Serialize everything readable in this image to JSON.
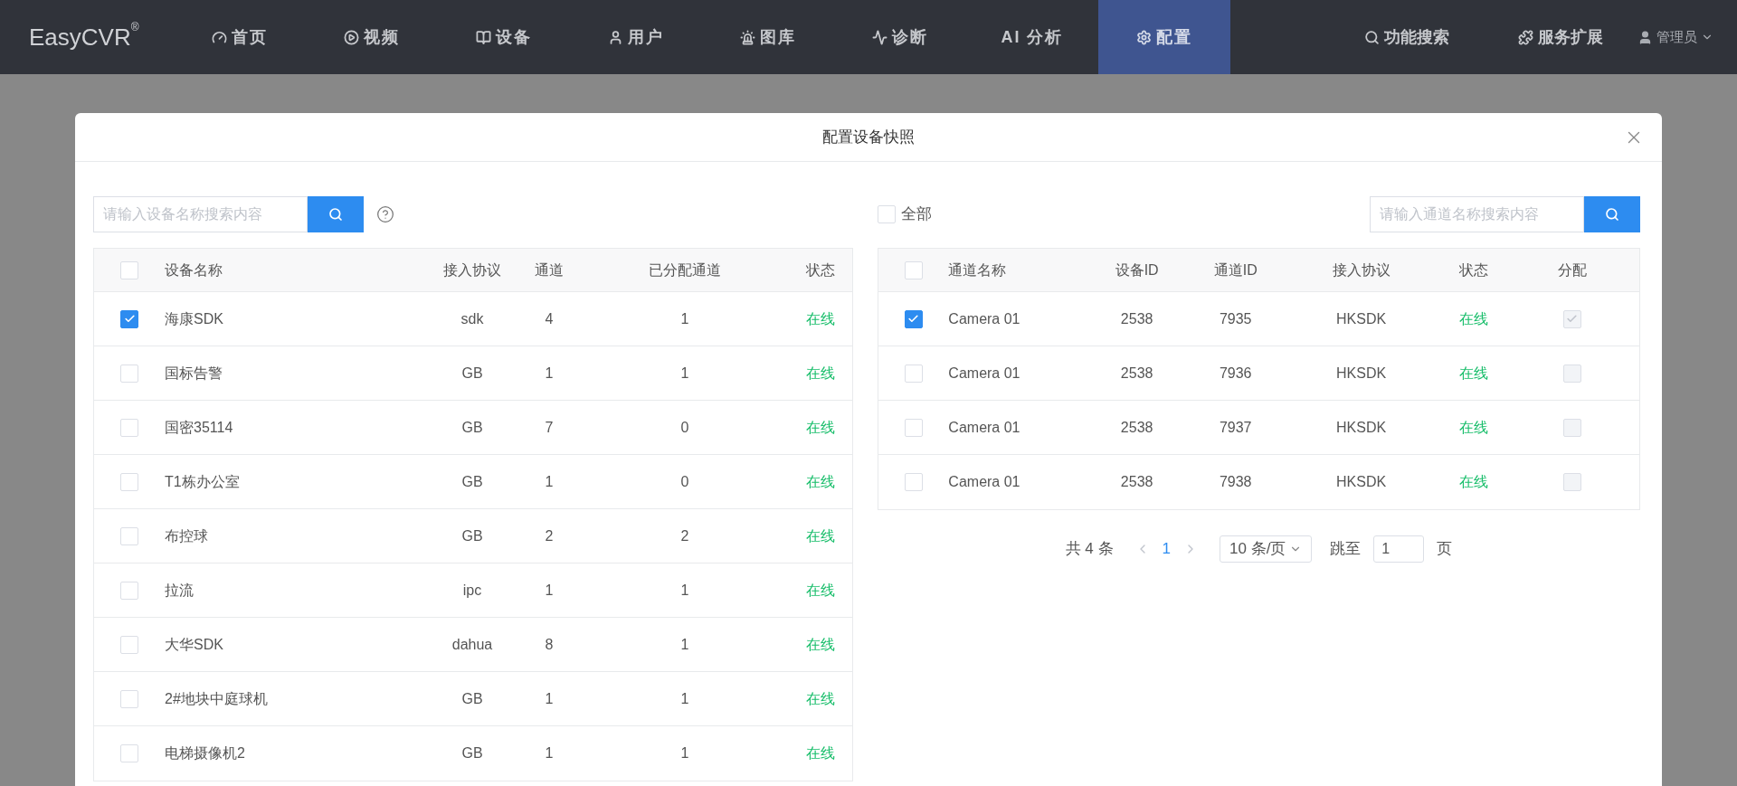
{
  "navbar": {
    "logo": "EasyCVR",
    "logo_mark": "®",
    "items": [
      {
        "label": "首页",
        "selected": false
      },
      {
        "label": "视频",
        "selected": false
      },
      {
        "label": "设备",
        "selected": false
      },
      {
        "label": "用户",
        "selected": false
      },
      {
        "label": "图库",
        "selected": false
      },
      {
        "label": "诊断",
        "selected": false
      },
      {
        "label": "AI 分析",
        "selected": false
      },
      {
        "label": "配置",
        "selected": true
      }
    ],
    "right_items": [
      {
        "label": "功能搜索"
      },
      {
        "label": "服务扩展"
      }
    ],
    "user": "管理员"
  },
  "dialog": {
    "title": "配置设备快照",
    "left": {
      "search": {
        "placeholder": "请输入设备名称搜索内容"
      },
      "header_checked": false,
      "columns": [
        "设备名称",
        "接入协议",
        "通道",
        "已分配通道",
        "状态"
      ],
      "rows": [
        {
          "checked": true,
          "cells": [
            "海康SDK",
            "sdk",
            "4",
            "1",
            "在线"
          ]
        },
        {
          "checked": false,
          "cells": [
            "国标告警",
            "GB",
            "1",
            "1",
            "在线"
          ]
        },
        {
          "checked": false,
          "cells": [
            "国密35114",
            "GB",
            "7",
            "0",
            "在线"
          ]
        },
        {
          "checked": false,
          "cells": [
            "T1栋办公室",
            "GB",
            "1",
            "0",
            "在线"
          ]
        },
        {
          "checked": false,
          "cells": [
            "布控球",
            "GB",
            "2",
            "2",
            "在线"
          ]
        },
        {
          "checked": false,
          "cells": [
            "拉流",
            "ipc",
            "1",
            "1",
            "在线"
          ]
        },
        {
          "checked": false,
          "cells": [
            "大华SDK",
            "dahua",
            "8",
            "1",
            "在线"
          ]
        },
        {
          "checked": false,
          "cells": [
            "2#地块中庭球机",
            "GB",
            "1",
            "1",
            "在线"
          ]
        },
        {
          "checked": false,
          "cells": [
            "电梯摄像机2",
            "GB",
            "1",
            "1",
            "在线"
          ]
        }
      ]
    },
    "right": {
      "select_all": {
        "label": "全部",
        "checked": false
      },
      "search": {
        "placeholder": "请输入通道名称搜索内容"
      },
      "header_checked": false,
      "columns": [
        "通道名称",
        "设备ID",
        "通道ID",
        "接入协议",
        "状态",
        "分配"
      ],
      "rows": [
        {
          "checked": true,
          "assigned": true,
          "cells": [
            "Camera 01",
            "2538",
            "7935",
            "HKSDK",
            "在线"
          ]
        },
        {
          "checked": false,
          "assigned": false,
          "cells": [
            "Camera 01",
            "2538",
            "7936",
            "HKSDK",
            "在线"
          ]
        },
        {
          "checked": false,
          "assigned": false,
          "cells": [
            "Camera 01",
            "2538",
            "7937",
            "HKSDK",
            "在线"
          ]
        },
        {
          "checked": false,
          "assigned": false,
          "cells": [
            "Camera 01",
            "2538",
            "7938",
            "HKSDK",
            "在线"
          ]
        }
      ],
      "pagination": {
        "total": "共 4 条",
        "pages": [
          {
            "label": "1",
            "selected": true
          }
        ],
        "page_size": "10 条/页",
        "jump_label": "跳至",
        "jump_value": "1",
        "page_suffix": "页"
      }
    }
  }
}
